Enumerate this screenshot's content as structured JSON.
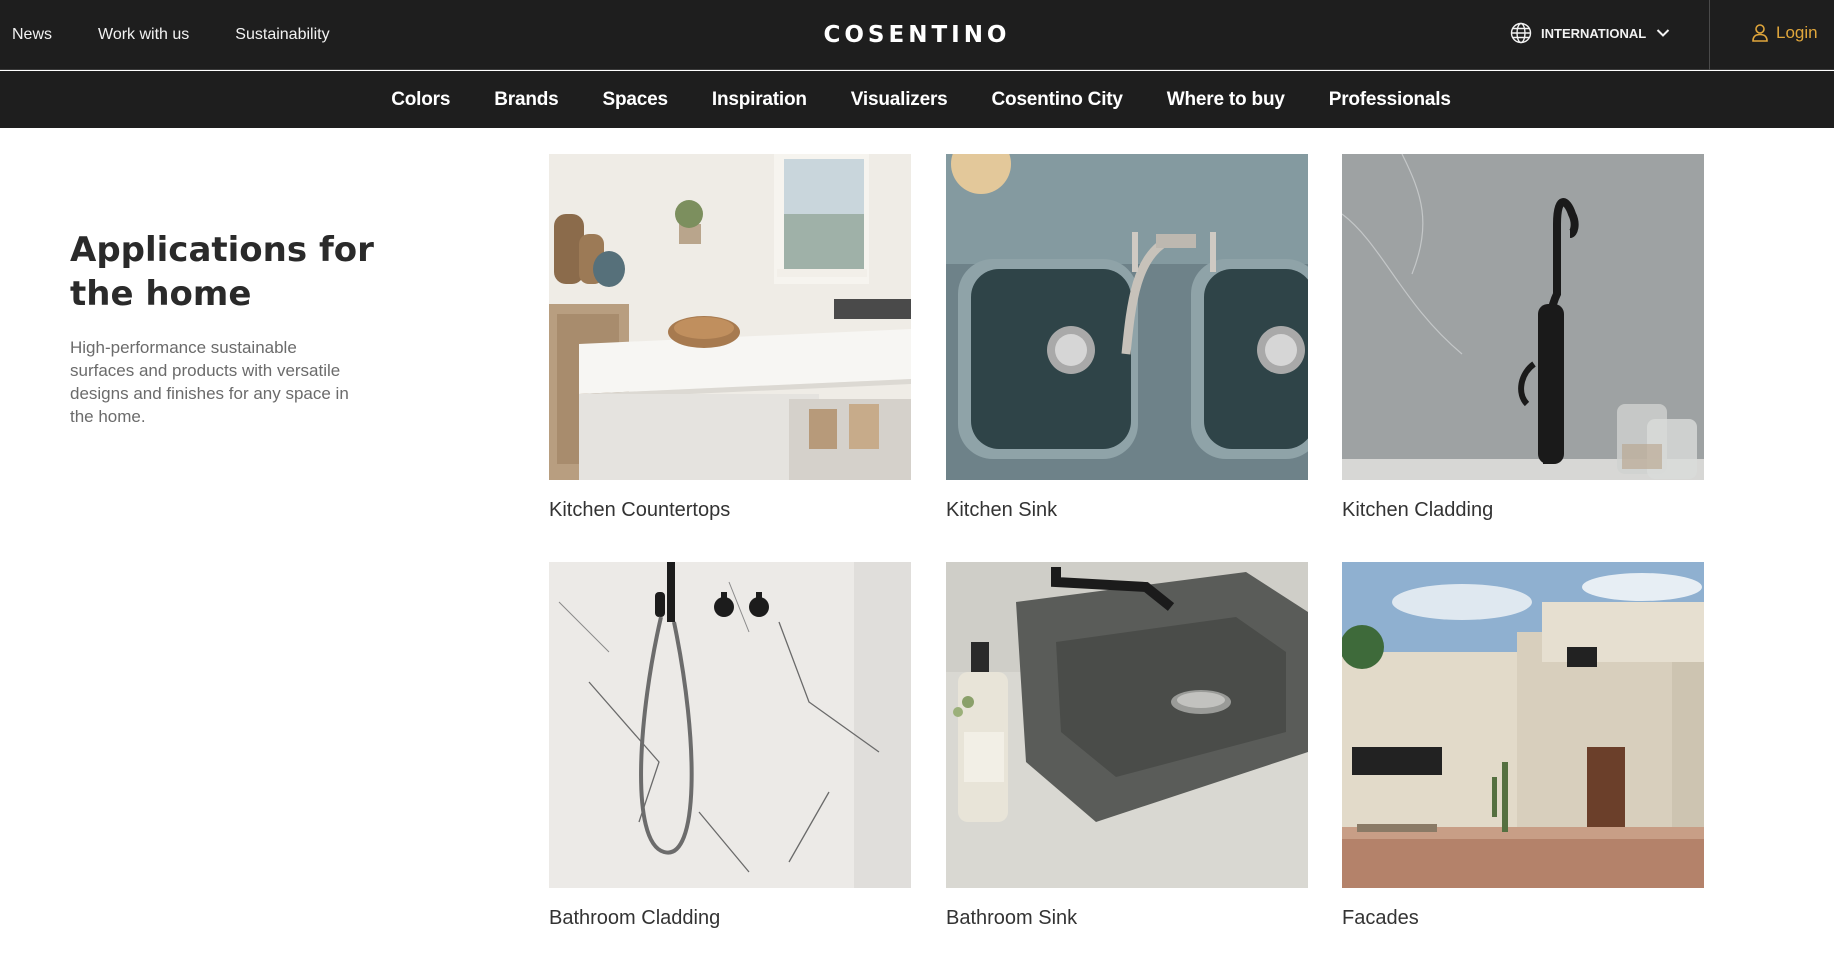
{
  "header": {
    "utility_links": [
      "News",
      "Work with us",
      "Sustainability"
    ],
    "logo": "COSENTINO",
    "region": "INTERNATIONAL",
    "login": "Login"
  },
  "nav": {
    "items": [
      "Colors",
      "Brands",
      "Spaces",
      "Inspiration",
      "Visualizers",
      "Cosentino City",
      "Where to buy",
      "Professionals"
    ]
  },
  "intro": {
    "title": "Applications for the home",
    "text": "High-performance sustainable surfaces and products with versatile designs and finishes for any space in the home."
  },
  "cards": [
    {
      "label": "Kitchen Countertops",
      "image": "kitchen-countertop-photo"
    },
    {
      "label": "Kitchen Sink",
      "image": "kitchen-sink-photo"
    },
    {
      "label": "Kitchen Cladding",
      "image": "kitchen-cladding-photo"
    },
    {
      "label": "Bathroom Cladding",
      "image": "bathroom-cladding-photo"
    },
    {
      "label": "Bathroom Sink",
      "image": "bathroom-sink-photo"
    },
    {
      "label": "Facades",
      "image": "facade-photo"
    }
  ],
  "colors": {
    "header_bg": "#1e1e1e",
    "login_accent": "#e0a63b"
  }
}
